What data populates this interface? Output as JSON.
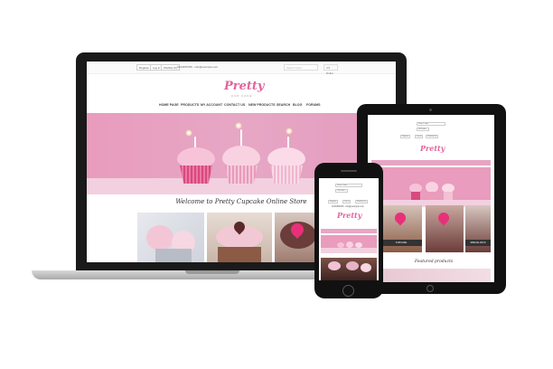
{
  "site": {
    "logo": "Pretty",
    "logo_sub": "CUP CAKE",
    "topbar": {
      "register": "Register",
      "login": "Log in",
      "wishlist": "Wishlist (0)",
      "phone": "0123456789 - info@example.com",
      "search_placeholder": "Search store",
      "currency": "US Dollar"
    },
    "nav": [
      "HOME PAGE",
      "PRODUCTS",
      "MY ACCOUNT",
      "CONTACT US",
      "NEW PRODUCTS",
      "SEARCH",
      "BLOG",
      "FORUMS"
    ],
    "welcome": "Welcome to Pretty Cupcake Online Store",
    "featured": "Featured products",
    "categories": [
      "CUPCAKE",
      "SPECIAL DAYS"
    ]
  },
  "colors": {
    "brand_pink": "#e0659c",
    "hero_pink": "#e99cbd",
    "frosting": "#f7c3d9",
    "device_black": "#111111"
  }
}
